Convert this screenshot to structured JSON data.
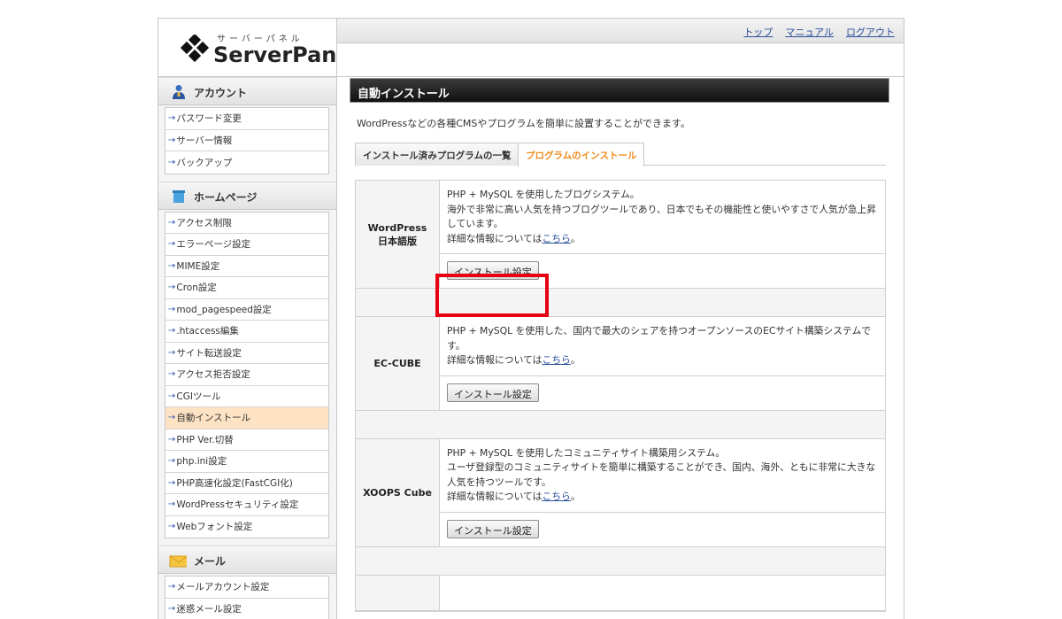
{
  "header": {
    "logo_kana": "サーバーパネル",
    "logo_text": "ServerPanel",
    "links": [
      "トップ",
      "マニュアル",
      "ログアウト"
    ]
  },
  "sidebar": {
    "sections": [
      {
        "title": "アカウント",
        "icon": "user-icon",
        "items": [
          "パスワード変更",
          "サーバー情報",
          "バックアップ"
        ]
      },
      {
        "title": "ホームページ",
        "icon": "homepage-icon",
        "items": [
          "アクセス制限",
          "エラーページ設定",
          "MIME設定",
          "Cron設定",
          "mod_pagespeed設定",
          ".htaccess編集",
          "サイト転送設定",
          "アクセス拒否設定",
          "CGIツール",
          "自動インストール",
          "PHP Ver.切替",
          "php.ini設定",
          "PHP高速化設定(FastCGI化)",
          "WordPressセキュリティ設定",
          "Webフォント設定"
        ]
      },
      {
        "title": "メール",
        "icon": "mail-icon",
        "items": [
          "メールアカウント設定",
          "迷惑メール設定"
        ]
      }
    ],
    "active_item": "自動インストール"
  },
  "main": {
    "title": "自動インストール",
    "description": "WordPressなどの各種CMSやプログラムを簡単に設置することができます。",
    "tabs": [
      {
        "label": "インストール済みプログラムの一覧",
        "active": false
      },
      {
        "label": "プログラムのインストール",
        "active": true
      }
    ],
    "programs": [
      {
        "name_line1": "WordPress",
        "name_line2": "日本語版",
        "desc_lines": [
          "PHP + MySQL を使用したブログシステム。",
          "海外で非常に高い人気を持つブログツールであり、日本でもその機能性と使いやすさで人気が急上昇しています。"
        ],
        "detail_prefix": "詳細な情報については",
        "detail_link": "こちら",
        "detail_suffix": "。",
        "button": "インストール設定"
      },
      {
        "name_line1": "EC-CUBE",
        "name_line2": "",
        "desc_lines": [
          "PHP + MySQL を使用した、国内で最大のシェアを持つオープンソースのECサイト構築システムです。"
        ],
        "detail_prefix": "詳細な情報については",
        "detail_link": "こちら",
        "detail_suffix": "。",
        "button": "インストール設定"
      },
      {
        "name_line1": "XOOPS Cube",
        "name_line2": "",
        "desc_lines": [
          "PHP + MySQL を使用したコミュニティサイト構築用システム。",
          "ユーザ登録型のコミュニティサイトを簡単に構築することができ、国内、海外、ともに非常に大きな人気を持つツールです。"
        ],
        "detail_prefix": "詳細な情報については",
        "detail_link": "こちら",
        "detail_suffix": "。",
        "button": "インストール設定"
      }
    ]
  },
  "colors": {
    "accent_tab": "#f08a1c",
    "highlight": "#e60012",
    "link": "#2a4f9a",
    "active_sidebar": "#fde3c4"
  }
}
